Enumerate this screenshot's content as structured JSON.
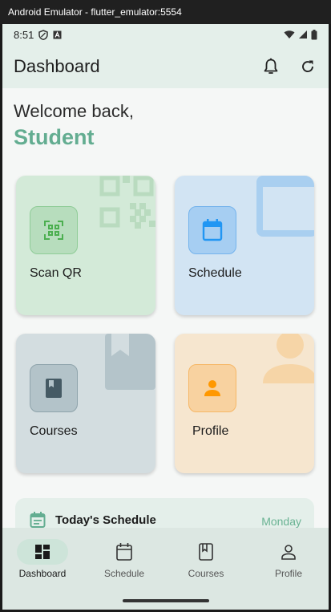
{
  "window": {
    "title": "Android Emulator - flutter_emulator:5554"
  },
  "status_bar": {
    "time": "8:51"
  },
  "app_bar": {
    "title": "Dashboard",
    "notifications_icon": "bell-icon",
    "refresh_icon": "refresh-icon"
  },
  "greeting": {
    "line1": "Welcome back,",
    "name": "Student"
  },
  "cards": [
    {
      "label": "Scan QR",
      "icon": "qr-scan-icon",
      "bg": "#d3ead8",
      "accent": "#4caf50"
    },
    {
      "label": "Schedule",
      "icon": "calendar-icon",
      "bg": "#d2e4f3",
      "accent": "#2196f3"
    },
    {
      "label": "Courses",
      "icon": "book-icon",
      "bg": "#d3dde0",
      "accent": "#455a64"
    },
    {
      "label": "Profile",
      "icon": "person-icon",
      "bg": "#f6e6cf",
      "accent": "#ff9800"
    }
  ],
  "todays_schedule": {
    "title": "Today's Schedule",
    "day": "Monday",
    "icon": "event-note-icon"
  },
  "bottom_nav": {
    "items": [
      {
        "label": "Dashboard",
        "icon": "dashboard-icon",
        "active": true
      },
      {
        "label": "Schedule",
        "icon": "calendar-icon",
        "active": false
      },
      {
        "label": "Courses",
        "icon": "book-icon",
        "active": false
      },
      {
        "label": "Profile",
        "icon": "person-icon",
        "active": false
      }
    ]
  },
  "colors": {
    "accent": "#63ad91",
    "app_bar_bg": "#e4efea",
    "nav_bg": "#dce7e2",
    "nav_active_pill": "#cde4d9"
  }
}
